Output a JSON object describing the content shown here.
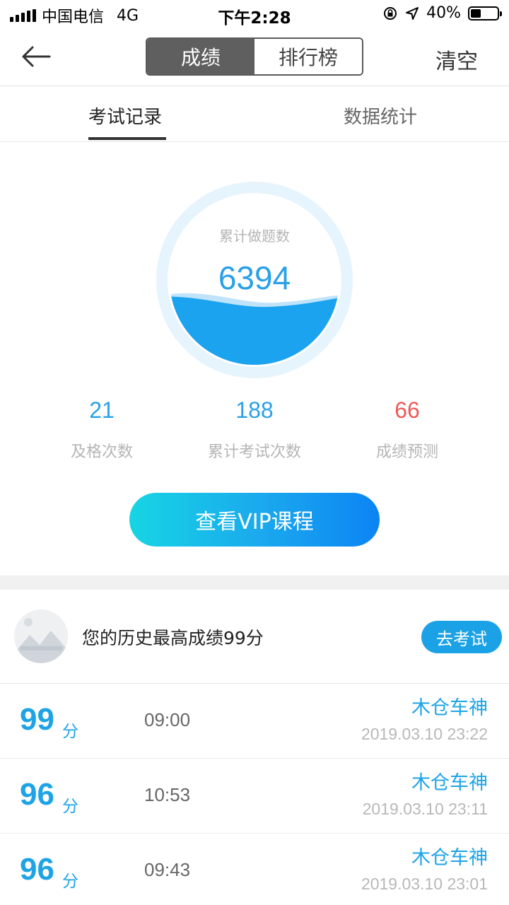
{
  "status_bar": {
    "carrier": "中国电信",
    "network": "4G",
    "time": "下午2:28",
    "battery_percent": "40%",
    "battery_level": 0.4
  },
  "nav": {
    "back_icon": "arrow-left-icon",
    "segments": [
      "成绩",
      "排行榜"
    ],
    "active_segment": 0,
    "clear_label": "清空"
  },
  "sub_tabs": {
    "items": [
      "考试记录",
      "数据统计"
    ],
    "active": 0
  },
  "summary": {
    "total_label": "累计做题数",
    "total_value": "6394",
    "stats": [
      {
        "value": "21",
        "label": "及格次数",
        "color": "#2aa0e6"
      },
      {
        "value": "188",
        "label": "累计考试次数",
        "color": "#2aa0e6"
      },
      {
        "value": "66",
        "label": "成绩预测",
        "color": "#ec5a5a"
      }
    ]
  },
  "vip_button": "查看VIP课程",
  "best": {
    "avatar_icon": "image-placeholder-icon",
    "text": "您的历史最高成绩99分",
    "go_exam": "去考试"
  },
  "records": [
    {
      "score": "99",
      "unit": "分",
      "duration": "09:00",
      "name": "木仓车神",
      "date": "2019.03.10 23:22"
    },
    {
      "score": "96",
      "unit": "分",
      "duration": "10:53",
      "name": "木仓车神",
      "date": "2019.03.10 23:11"
    },
    {
      "score": "96",
      "unit": "分",
      "duration": "09:43",
      "name": "木仓车神",
      "date": "2019.03.10 23:01"
    }
  ],
  "colors": {
    "accent": "#1ea4e6",
    "warning": "#ec5a5a",
    "wave": "#1ba3f0"
  }
}
